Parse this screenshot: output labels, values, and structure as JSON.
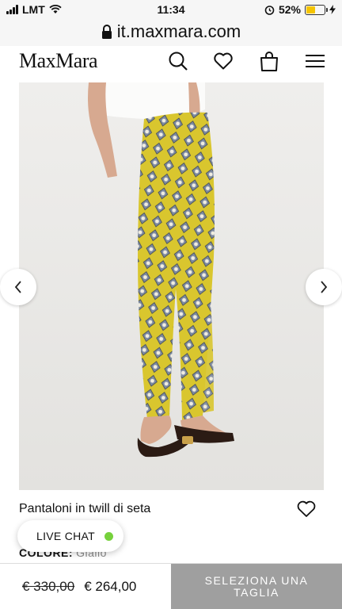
{
  "status_bar": {
    "carrier": "LMT",
    "time": "11:34",
    "battery_percent": "52%",
    "battery_level": 0.52,
    "battery_color": "#f5c400"
  },
  "browser": {
    "url": "it.maxmara.com"
  },
  "header": {
    "logo": "MaxMara",
    "icons": [
      "search-icon",
      "heart-icon",
      "bag-icon",
      "menu-icon"
    ]
  },
  "gallery": {
    "prev_icon": "chevron-left-icon",
    "next_icon": "chevron-right-icon"
  },
  "product": {
    "name": "Pantaloni in twill di seta",
    "color_label": "COLORE:",
    "color_value": "Giallo",
    "pattern_color": "#d9c62e"
  },
  "chat": {
    "label": "LIVE CHAT",
    "status_color": "#76d13c"
  },
  "purchase": {
    "old_price": "€ 330,00",
    "new_price": "€ 264,00",
    "cta_line1": "SELEZIONA UNA",
    "cta_line2": "TAGLIA"
  }
}
